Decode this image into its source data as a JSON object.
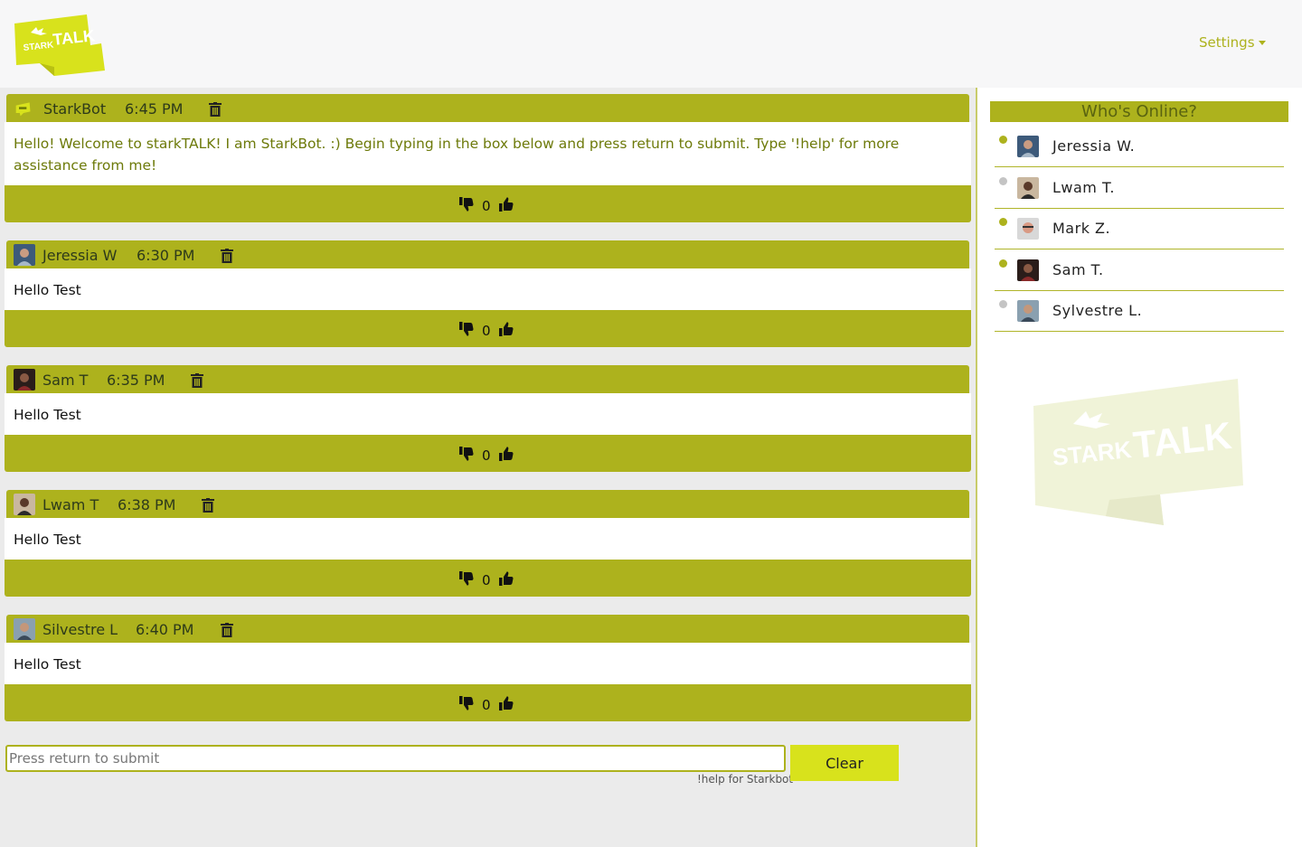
{
  "header": {
    "logo_text": {
      "stark": "STARK",
      "talk": "TALK"
    },
    "settings_label": "Settings"
  },
  "messages": [
    {
      "author": "StarkBot",
      "time": "6:45 PM",
      "text": "Hello! Welcome to starkTALK! I am StarkBot. :) Begin typing in the box below and press return to submit. Type '!help' for more assistance from me!",
      "votes": "0",
      "bot": true
    },
    {
      "author": "Jeressia W",
      "time": "6:30 PM",
      "text": "Hello Test",
      "votes": "0"
    },
    {
      "author": "Sam T",
      "time": "6:35 PM",
      "text": "Hello Test",
      "votes": "0"
    },
    {
      "author": "Lwam T",
      "time": "6:38 PM",
      "text": "Hello Test",
      "votes": "0"
    },
    {
      "author": "Silvestre L",
      "time": "6:40 PM",
      "text": "Hello Test",
      "votes": "0"
    }
  ],
  "composer": {
    "placeholder": "Press return to submit",
    "hint": "!help for Starkbot",
    "clear_label": "Clear"
  },
  "sidebar": {
    "title": "Who's Online?",
    "users": [
      {
        "name": "Jeressia W.",
        "online": true
      },
      {
        "name": "Lwam T.",
        "online": false
      },
      {
        "name": "Mark Z.",
        "online": true
      },
      {
        "name": "Sam T.",
        "online": true
      },
      {
        "name": "Sylvestre L.",
        "online": false
      }
    ]
  },
  "colors": {
    "accent": "#adb21d",
    "accent_bright": "#d8e21c",
    "online": "#adb21d",
    "offline": "#c4c4c4"
  },
  "icons": {
    "trash": "trash-icon",
    "thumbs_down": "thumbs-down-icon",
    "thumbs_up": "thumbs-up-icon",
    "caret": "caret-down-icon"
  }
}
